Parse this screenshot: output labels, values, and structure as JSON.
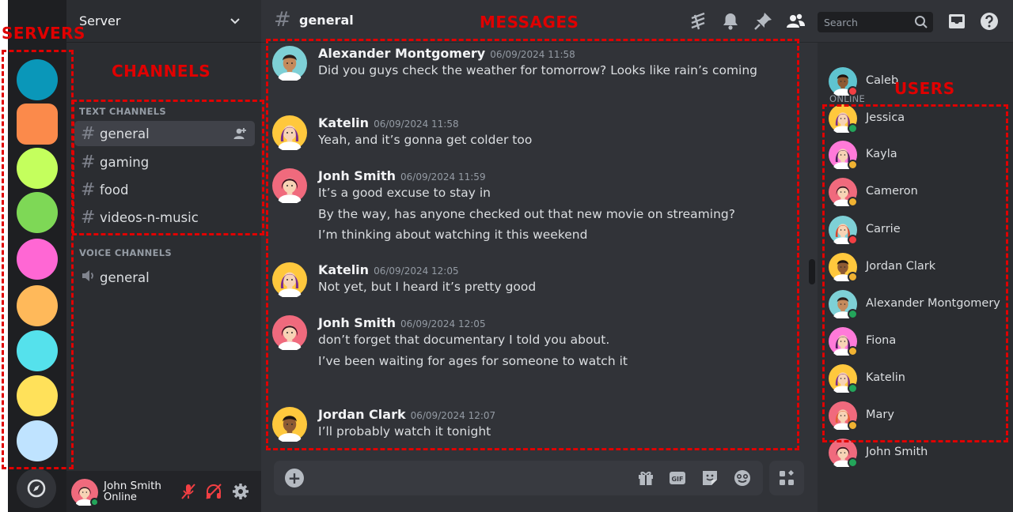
{
  "annotations": {
    "servers": "SERVERS",
    "channels": "CHANNELS",
    "messages": "MESSAGES",
    "users": "USERS"
  },
  "servers": [
    {
      "color": "#0a97b9",
      "shape": "circle"
    },
    {
      "color": "#fb8a4b",
      "shape": "square"
    },
    {
      "color": "#c4ff5d",
      "shape": "circle"
    },
    {
      "color": "#7ed856",
      "shape": "circle"
    },
    {
      "color": "#ff67d4",
      "shape": "circle"
    },
    {
      "color": "#ffb95a",
      "shape": "circle"
    },
    {
      "color": "#55e1ec",
      "shape": "circle"
    },
    {
      "color": "#ffe15a",
      "shape": "circle"
    },
    {
      "color": "#bfe3ff",
      "shape": "circle"
    }
  ],
  "sidebar": {
    "server_name": "Server",
    "text_category": "TEXT CHANNELS",
    "voice_category": "VOICE CHANNELS",
    "text_channels": [
      "general",
      "gaming",
      "food",
      "videos-n-music"
    ],
    "voice_channels": [
      "general"
    ]
  },
  "user_panel": {
    "name": "John Smith",
    "status": "Online"
  },
  "header": {
    "channel": "general",
    "search_placeholder": "Search"
  },
  "messages": [
    {
      "author": "Alexander Montgomery",
      "time": "06/09/2024 11:58",
      "lines": [
        "Did you guys check the weather for tomorrow? Looks like rain’s coming"
      ]
    },
    {
      "author": "Katelin",
      "time": "06/09/2024 11:58",
      "lines": [
        "Yeah, and it’s gonna get colder too"
      ]
    },
    {
      "author": "Jonh Smith",
      "time": "06/09/2024 11:59",
      "lines": [
        "It’s a good excuse to stay in",
        "By the way, has anyone checked out that new movie on streaming?",
        "I’m thinking about watching it this weekend"
      ]
    },
    {
      "author": "Katelin",
      "time": "06/09/2024 12:05",
      "lines": [
        "Not yet, but I heard it’s pretty good"
      ]
    },
    {
      "author": "Jonh Smith",
      "time": "06/09/2024 12:05",
      "lines": [
        "don’t forget that documentary I told you about.",
        "I’ve been waiting for ages for someone to watch it"
      ]
    },
    {
      "author": "Jordan Clark",
      "time": "06/09/2024 12:07",
      "lines": [
        "I’ll probably watch it tonight"
      ]
    }
  ],
  "members": {
    "heading": "ONLINE",
    "list": [
      {
        "name": "Caleb",
        "status": "dnd"
      },
      {
        "name": "Jessica",
        "status": "online"
      },
      {
        "name": "Kayla",
        "status": "idle"
      },
      {
        "name": "Cameron",
        "status": "idle"
      },
      {
        "name": "Carrie",
        "status": "dnd"
      },
      {
        "name": "Jordan Clark",
        "status": "idle"
      },
      {
        "name": "Alexander Montgomery",
        "status": "online"
      },
      {
        "name": "Fiona",
        "status": "idle"
      },
      {
        "name": "Katelin",
        "status": "online"
      },
      {
        "name": "Mary",
        "status": "idle"
      },
      {
        "name": "John Smith",
        "status": "online"
      }
    ]
  },
  "colors": {
    "annotation": "#e00000",
    "status_online": "#23a55a",
    "status_idle": "#f0b232",
    "status_dnd": "#f23f43",
    "muted_red": "#f23f43"
  }
}
